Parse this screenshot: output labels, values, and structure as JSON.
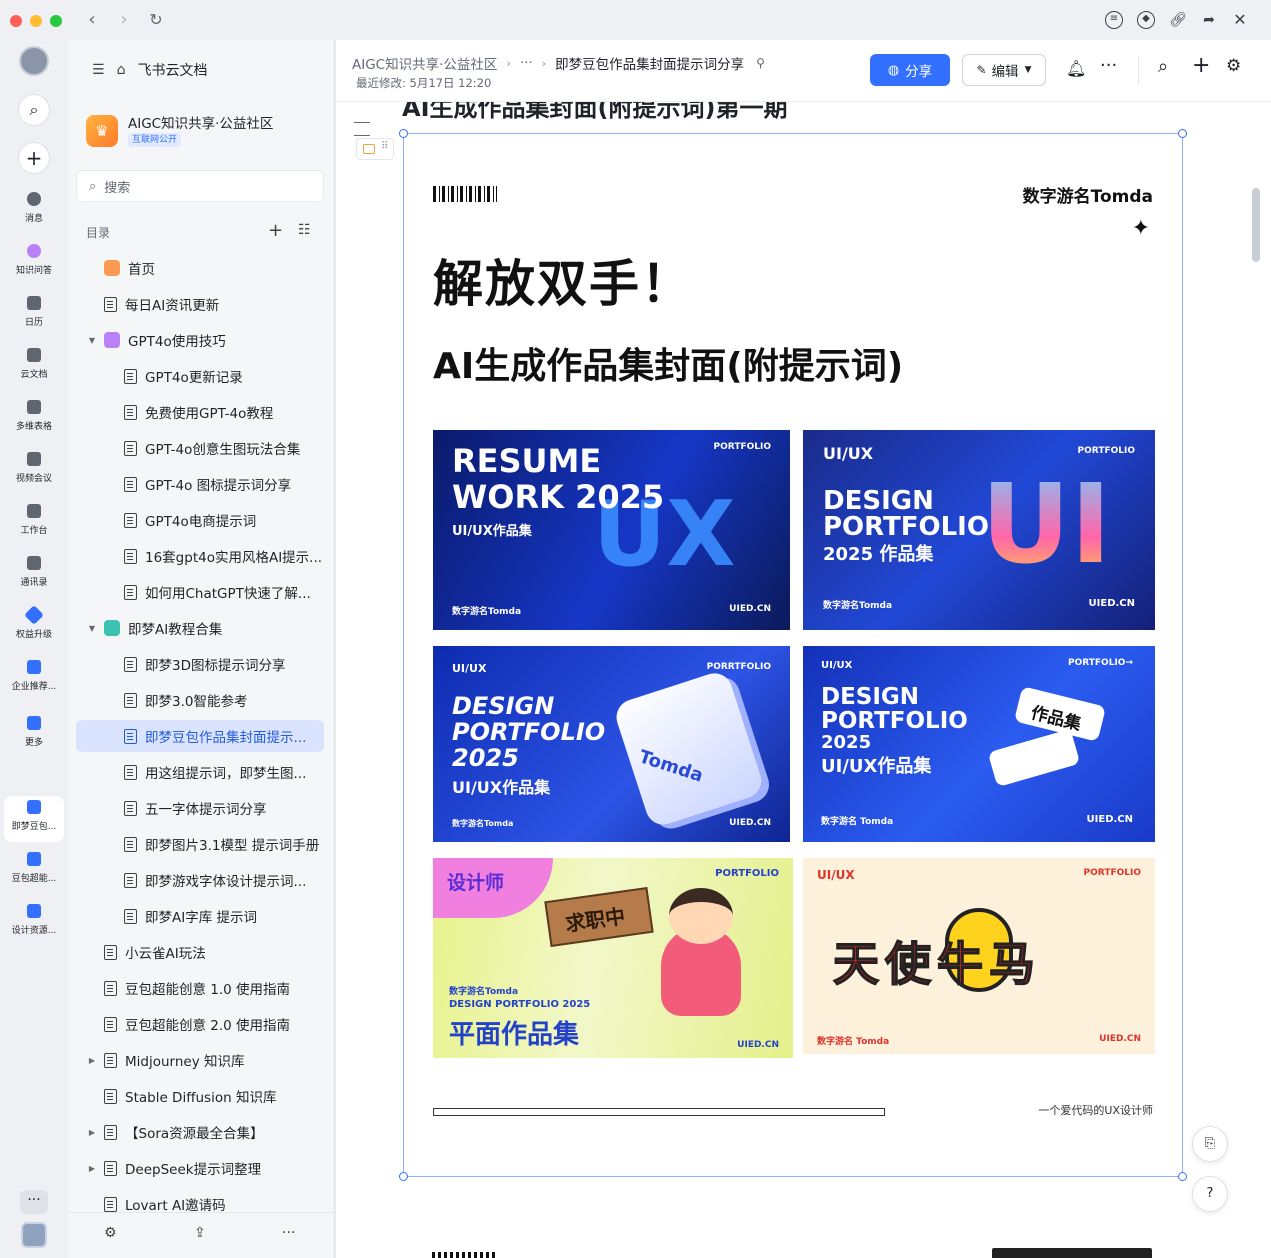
{
  "titlebar": {
    "back": "‹",
    "forward": "›",
    "reload": "↻"
  },
  "rail": {
    "items": [
      {
        "label": "消息"
      },
      {
        "label": "知识问答"
      },
      {
        "label": "日历"
      },
      {
        "label": "云文档"
      },
      {
        "label": "多维表格"
      },
      {
        "label": "视频会议"
      },
      {
        "label": "工作台"
      },
      {
        "label": "通讯录"
      },
      {
        "label": "权益升级"
      },
      {
        "label": "企业推荐..."
      },
      {
        "label": "更多"
      },
      {
        "label": "即梦豆包..."
      },
      {
        "label": "豆包超能..."
      },
      {
        "label": "设计资源..."
      }
    ],
    "more": "···"
  },
  "sidebar": {
    "app_title": "飞书云文档",
    "space_name": "AIGC知识共享·公益社区",
    "space_badge": "互联网公开",
    "search_placeholder": "搜索",
    "toc_label": "目录",
    "tree": [
      {
        "label": "首页"
      },
      {
        "label": "每日AI资讯更新"
      },
      {
        "label": "GPT4o使用技巧"
      },
      {
        "label": "GPT4o更新记录"
      },
      {
        "label": "免费使用GPT-4o教程"
      },
      {
        "label": "GPT-4o创意生图玩法合集"
      },
      {
        "label": "GPT-4o 图标提示词分享"
      },
      {
        "label": "GPT4o电商提示词"
      },
      {
        "label": "16套gpt4o实用风格AI提示..."
      },
      {
        "label": "如何用ChatGPT快速了解..."
      },
      {
        "label": "即梦AI教程合集"
      },
      {
        "label": "即梦3D图标提示词分享"
      },
      {
        "label": "即梦3.0智能参考"
      },
      {
        "label": "即梦豆包作品集封面提示..."
      },
      {
        "label": "用这组提示词，即梦生图..."
      },
      {
        "label": "五一字体提示词分享"
      },
      {
        "label": "即梦图片3.1模型 提示词手册"
      },
      {
        "label": "即梦游戏字体设计提示词..."
      },
      {
        "label": "即梦AI字库 提示词"
      },
      {
        "label": "小云雀AI玩法"
      },
      {
        "label": "豆包超能创意 1.0 使用指南"
      },
      {
        "label": "豆包超能创意 2.0 使用指南"
      },
      {
        "label": "Midjourney 知识库"
      },
      {
        "label": "Stable Diffusion 知识库"
      },
      {
        "label": "【Sora资源最全合集】"
      },
      {
        "label": "DeepSeek提示词整理"
      },
      {
        "label": "Lovart AI邀请码"
      }
    ]
  },
  "header": {
    "crumb_space": "AIGC知识共享·公益社区",
    "crumb_more": "···",
    "crumb_current": "即梦豆包作品集封面提示词分享",
    "modified": "最近修改: 5月17日 12:20",
    "share_label": "分享",
    "edit_label": "编辑"
  },
  "doc": {
    "clipped_title": "AI生成作品集封面(附提示词)第一期",
    "poster": {
      "brand": "数字游名Tomda",
      "headline": "解放双手！",
      "subhead": "AI生成作品集封面(附提示词)",
      "footer": "一个爱代码的UX设计师",
      "cards": [
        {
          "l1": "RESUME",
          "l2": "WORK 2025",
          "l3": "UI/UX作品集",
          "tag": "PORTFOLIO",
          "brand": "数字游名Tomda",
          "site": "UIED.CN",
          "big": "UX"
        },
        {
          "l1": "UI/UX",
          "l2": "DESIGN",
          "l3": "PORTFOLIO",
          "l4": "2025 作品集",
          "tag": "PORTFOLIO",
          "brand": "数字游名Tomda",
          "site": "UIED.CN",
          "big": "UI"
        },
        {
          "l1": "UI/UX",
          "l2": "DESIGN",
          "l3": "PORTFOLIO",
          "l4": "2025",
          "l5": "UI/UX作品集",
          "tag": "PORRTFOLIO",
          "brand": "数字游名Tomda",
          "site": "UIED.CN",
          "big": "Tomda"
        },
        {
          "l1": "UI/UX",
          "l2": "DESIGN",
          "l3": "PORTFOLIO",
          "l4": "2025",
          "l5": "UI/UX作品集",
          "tag": "PORTFOLIO→",
          "brand": "数字游名 Tomda",
          "site": "UIED.CN",
          "big": "作品集"
        },
        {
          "l1": "设计师",
          "sign": "求职中",
          "brand": "数字游名Tomda",
          "l3": "DESIGN PORTFOLIO 2025",
          "l4": "平面作品集",
          "tag": "PORTFOLIO",
          "site": "UIED.CN"
        },
        {
          "l1": "UI/UX",
          "big": "天使牛马",
          "brand": "数字游名 Tomda",
          "tag": "PORTFOLIO",
          "site": "UIED.CN"
        }
      ]
    }
  },
  "colors": {
    "accent": "#3370ff",
    "active_bg": "#dbe4ff",
    "highlight": "#6ee36a"
  }
}
